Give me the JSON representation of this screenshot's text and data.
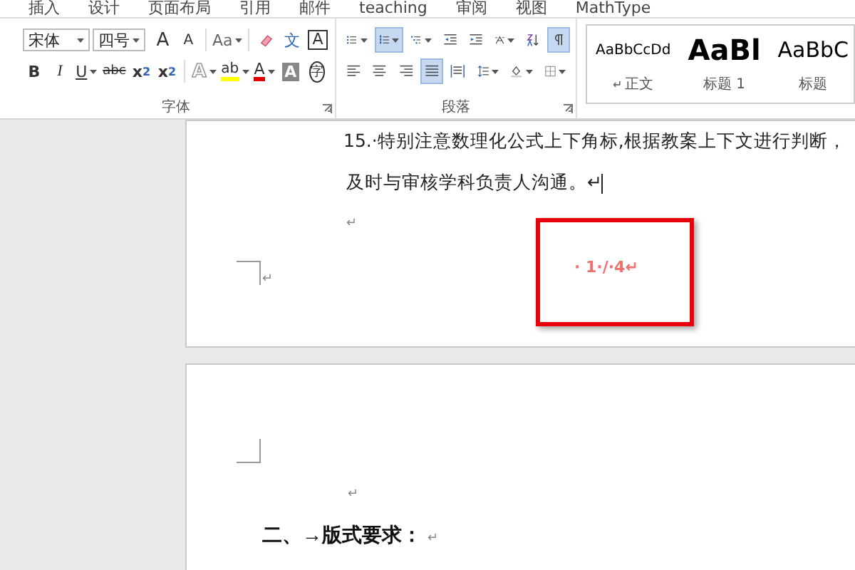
{
  "tabs": [
    {
      "label": "插入"
    },
    {
      "label": "设计"
    },
    {
      "label": "页面布局"
    },
    {
      "label": "引用"
    },
    {
      "label": "邮件"
    },
    {
      "label": "teaching"
    },
    {
      "label": "审阅"
    },
    {
      "label": "视图"
    },
    {
      "label": "MathType"
    }
  ],
  "font_group": {
    "font_field": {
      "value": "宋体"
    },
    "size_field": {
      "value": "四号"
    },
    "row_1": [
      {
        "kind": "grow",
        "label": "A",
        "on": false
      },
      {
        "kind": "shrink",
        "label": "A",
        "on": false
      },
      {
        "kind": "case",
        "label": "Aa",
        "on": false
      },
      {
        "kind": "eraser",
        "on": false
      },
      {
        "kind": "pinyin",
        "label": "文",
        "on": false
      },
      {
        "kind": "border",
        "label": "A",
        "on": false
      }
    ],
    "row_2": [
      {
        "kind": "bold",
        "label": "B",
        "on": false
      },
      {
        "kind": "italic",
        "label": "I",
        "on": false
      },
      {
        "kind": "underline",
        "label": "U",
        "on": false
      },
      {
        "kind": "strike",
        "label": "abc",
        "on": false
      },
      {
        "kind": "sub",
        "label": "x",
        "index": "2",
        "on": false
      },
      {
        "kind": "sup",
        "label": "x",
        "index": "2",
        "on": false
      },
      {
        "kind": "effect",
        "label": "A",
        "on": false
      },
      {
        "kind": "highlight",
        "label": "ab",
        "on": false
      },
      {
        "kind": "color",
        "label": "A",
        "on": false
      },
      {
        "kind": "shade",
        "label": "A",
        "on": false
      },
      {
        "kind": "enclose",
        "label": "字",
        "on": false
      }
    ],
    "label": "字体"
  },
  "paragraph_group": {
    "row_1": [
      {
        "kind": "bullets",
        "on": false
      },
      {
        "kind": "numbering",
        "on": true
      },
      {
        "kind": "multilevel",
        "on": false
      },
      {
        "kind": "outdent",
        "on": false
      },
      {
        "kind": "indent",
        "on": false
      },
      {
        "kind": "asian",
        "on": false
      },
      {
        "kind": "sort",
        "on": false
      },
      {
        "kind": "marks",
        "on": true
      }
    ],
    "row_2": [
      {
        "kind": "left",
        "on": false
      },
      {
        "kind": "center",
        "on": false
      },
      {
        "kind": "right",
        "on": false
      },
      {
        "kind": "justify",
        "on": true
      },
      {
        "kind": "distribute",
        "on": false
      },
      {
        "kind": "spacing",
        "on": false
      },
      {
        "kind": "fill",
        "on": false
      },
      {
        "kind": "borders",
        "on": false
      }
    ],
    "label": "段落"
  },
  "styles": [
    {
      "preview": "AaBbCcDd",
      "kind": "normal",
      "mark": "↵",
      "name": "正文"
    },
    {
      "preview": "AaBl",
      "kind": "heading1",
      "name": "标题 1"
    },
    {
      "preview": "AaBbC",
      "kind": "title",
      "name": "标题"
    }
  ],
  "page_1": {
    "lines": [
      {
        "kind": "item",
        "text": "15.·特别注意数理化公式上下角标,根据教案上下文进行判断，"
      },
      {
        "kind": "cont",
        "text": "及时与审核学科负责人沟通。↵"
      },
      {
        "kind": "empty",
        "text": "↵"
      }
    ],
    "corner_mark": "↵",
    "footer": "· 1·/·4↵"
  },
  "page_2": {
    "empty_mark": "↵",
    "heading": "二、→版式要求：",
    "heading_mark": "↵"
  }
}
